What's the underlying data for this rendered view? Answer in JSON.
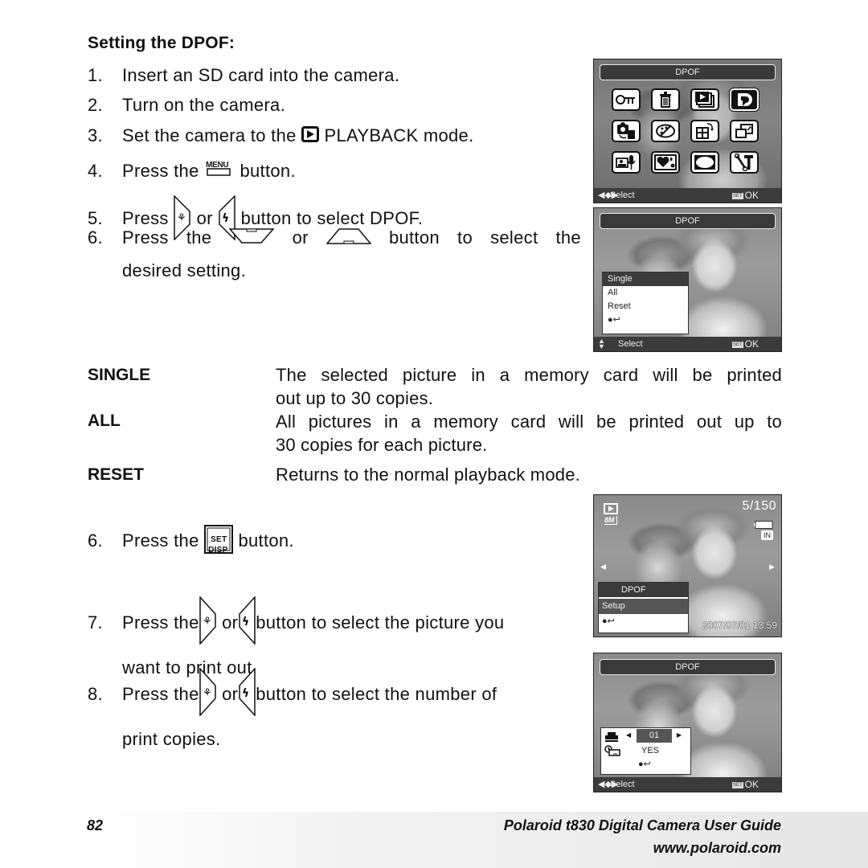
{
  "heading": "Setting the DPOF:",
  "steps_part1": [
    {
      "num": "1.",
      "text": "Insert an SD card into the camera."
    },
    {
      "num": "2.",
      "text": "Turn on the camera."
    },
    {
      "num": "3.",
      "pre": "Set the camera to the",
      "icon": "playback-icon",
      "post": "PLAYBACK mode."
    },
    {
      "num": "4.",
      "pre": "Press the",
      "icon": "menu-button-icon",
      "icon_label": "MENU",
      "post": "button."
    },
    {
      "num": "5.",
      "pre": "Press",
      "icon1": "macro-right-button-icon",
      "mid": "or",
      "icon2": "flash-left-button-icon",
      "post": "button to select DPOF."
    },
    {
      "num": "6.",
      "words": [
        "Press",
        "the",
        "",
        "or",
        "",
        "button",
        "to",
        "select",
        "the"
      ],
      "pre": "Press the",
      "icon1": "down-button-icon",
      "mid": "or",
      "icon2": "up-button-icon",
      "post": "button to select the",
      "cont": "desired setting."
    }
  ],
  "options": [
    {
      "term": "SINGLE",
      "desc": "The selected picture in a memory card will be printed out up to 30 copies.",
      "desc_lines": [
        "The selected picture in a memory card will be printed",
        "out up to 30 copies."
      ]
    },
    {
      "term": "ALL",
      "desc": "All pictures in a memory card will be printed out up to 30 copies for each picture.",
      "desc_lines": [
        "All pictures in a memory card will be printed out up to",
        "30 copies for each picture."
      ]
    },
    {
      "term": "RESET",
      "desc": "Returns to the normal playback mode.",
      "desc_lines": [
        "Returns to the normal playback mode."
      ]
    }
  ],
  "steps_part2": [
    {
      "num": "6.",
      "pre": "Press the",
      "icon": "set-disp-button-icon",
      "icon_label_top": "SET",
      "icon_label_bottom": "DISP",
      "post": "button."
    },
    {
      "num": "7.",
      "pre": "Press the",
      "icon1": "macro-right-button-icon",
      "mid": "or",
      "icon2": "flash-left-button-icon",
      "post": "button to select the picture you",
      "cont": "want to print out."
    },
    {
      "num": "8.",
      "pre": "Press the",
      "icon1": "macro-right-button-icon",
      "mid": "or",
      "icon2": "flash-left-button-icon",
      "post": "button to select the number of",
      "cont": "print copies."
    }
  ],
  "screens": {
    "menu": {
      "title": "DPOF",
      "icons": [
        "protect-key-icon",
        "delete-trash-icon",
        "slideshow-icon",
        "dpof-print-icon",
        "copy-to-card-icon",
        "color-effect-palette-icon",
        "rotate-icon",
        "resize-icon",
        "voice-memo-icon",
        "startup-image-icon",
        "frame-icon",
        "setup-tools-icon"
      ],
      "selected_index": 3,
      "status_select": "Select",
      "status_set": "SET",
      "status_ok": "OK"
    },
    "dpof_options": {
      "title": "DPOF",
      "items": [
        "Single",
        "All",
        "Reset"
      ],
      "selected": "Single",
      "back_label": "●↩",
      "status_select": "Select",
      "status_set": "SET",
      "status_ok": "OK"
    },
    "playback": {
      "counter": "5/150",
      "resolution": "8M",
      "storage": "IN",
      "popup_title": "DPOF",
      "popup_item": "Setup",
      "back_label": "●↩",
      "datetime": "2007/07/01  13:59"
    },
    "copies": {
      "title": "DPOF",
      "copies_value": "01",
      "date_value": "YES",
      "back_label": "●↩",
      "status_select": "Select",
      "status_set": "SET",
      "status_ok": "OK"
    }
  },
  "footer": {
    "page_number": "82",
    "guide_title": "Polaroid t830 Digital Camera User Guide",
    "url": "www.polaroid.com"
  }
}
